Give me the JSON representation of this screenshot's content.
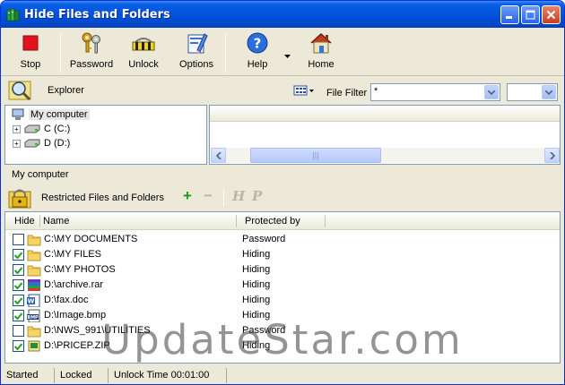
{
  "window": {
    "title": "Hide Files and Folders"
  },
  "toolbar": {
    "buttons": [
      {
        "label": "Stop",
        "icon": "stop-icon"
      },
      {
        "label": "Password",
        "icon": "keys-icon"
      },
      {
        "label": "Unlock",
        "icon": "unlock-icon"
      },
      {
        "label": "Options",
        "icon": "options-icon"
      },
      {
        "label": "Help",
        "icon": "help-icon"
      },
      {
        "label": "Home",
        "icon": "home-icon"
      }
    ]
  },
  "explorer": {
    "label": "Explorer",
    "file_filter_label": "File Filter",
    "file_filter_value": "*",
    "tree": [
      {
        "label": "My computer",
        "icon": "computer-icon"
      },
      {
        "label": "C (C:)",
        "icon": "drive-icon"
      },
      {
        "label": "D (D:)",
        "icon": "drive-icon"
      }
    ],
    "current_path": "My computer"
  },
  "restricted": {
    "label": "Restricted Files and Folders",
    "tools": [
      "+",
      "−",
      "H",
      "P"
    ],
    "columns": [
      "Hide",
      "Name",
      "Protected by"
    ],
    "rows": [
      {
        "checked": false,
        "icon": "folder-icon",
        "name": "C:\\MY DOCUMENTS",
        "protected_by": "Password"
      },
      {
        "checked": true,
        "icon": "folder-icon",
        "name": "C:\\MY FILES",
        "protected_by": "Hiding"
      },
      {
        "checked": true,
        "icon": "folder-icon",
        "name": "C:\\MY PHOTOS",
        "protected_by": "Hiding"
      },
      {
        "checked": true,
        "icon": "rar-icon",
        "name": "D:\\archive.rar",
        "protected_by": "Hiding"
      },
      {
        "checked": true,
        "icon": "doc-icon",
        "name": "D:\\fax.doc",
        "protected_by": "Hiding"
      },
      {
        "checked": true,
        "icon": "bmp-icon",
        "name": "D:\\Image.bmp",
        "protected_by": "Hiding"
      },
      {
        "checked": false,
        "icon": "folder-icon",
        "name": "D:\\NWS_991\\UTILITIES",
        "protected_by": "Password"
      },
      {
        "checked": true,
        "icon": "zip-icon",
        "name": "D:\\PRICEP.ZIP",
        "protected_by": "Hiding"
      }
    ]
  },
  "status": {
    "state": "Started",
    "lock": "Locked",
    "unlock_time": "Unlock Time 00:01:00"
  },
  "watermark": "UpdateStar.com",
  "colors": {
    "titlebar": "#0254dc",
    "window_bg": "#ece9d8",
    "check": "#21a121",
    "stop": "#e0141e"
  }
}
